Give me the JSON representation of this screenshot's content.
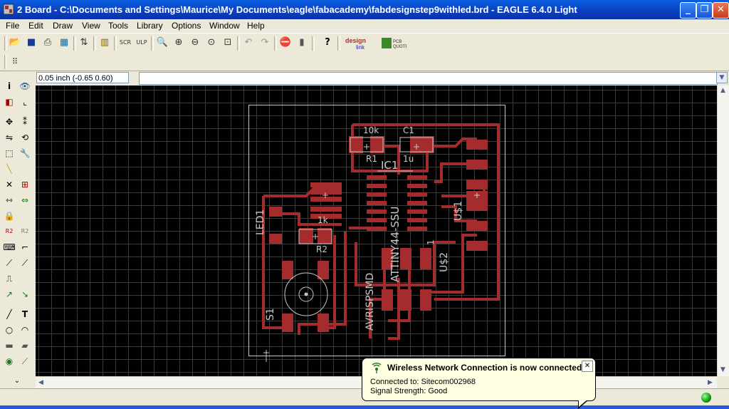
{
  "window": {
    "title": "2 Board - C:\\Documents and Settings\\Maurice\\My Documents\\eagle\\fabacademy\\fabdesignstep9withled.brd - EAGLE 6.4.0 Light",
    "controls": [
      "minimize",
      "maximize",
      "close"
    ]
  },
  "menu": [
    "File",
    "Edit",
    "Draw",
    "View",
    "Tools",
    "Library",
    "Options",
    "Window",
    "Help"
  ],
  "toolbar_icons": [
    "open-icon",
    "save-icon",
    "print-icon",
    "cam-icon",
    "script-icon",
    "library-icon",
    "scr-icon",
    "ulp-icon",
    "zoom-fit-icon",
    "zoom-in-icon",
    "zoom-out-icon",
    "zoom-redraw-icon",
    "zoom-select-icon",
    "undo-icon",
    "redo-icon",
    "stop-icon",
    "go-icon",
    "help-icon",
    "design-link-icon",
    "pcb-quote-icon"
  ],
  "coordinates": "0.05 inch (-0.65 0.60)",
  "command_input": "",
  "left_tools": [
    "info",
    "show",
    "display",
    "mark",
    "move",
    "copy",
    "mirror",
    "rotate",
    "group",
    "change",
    "delete",
    "add",
    "paste",
    "smash",
    "name",
    "value",
    "miter",
    "split",
    "optimize",
    "route",
    "ripup",
    "wire",
    "text",
    "circle",
    "arc",
    "rect",
    "polygon",
    "via",
    "signal"
  ],
  "board": {
    "labels": {
      "r1_value": "10k",
      "c1_value": "1u",
      "r1_name": "R1",
      "c1_name": "C1",
      "ic1_name": "IC1",
      "ic1_value": "ATTINY44-SSU",
      "us1": "U$1",
      "us2": "U$2",
      "led1": "LED1",
      "r2_value": "1k",
      "r2_name": "R2",
      "avrisp": "AVRISPSMD",
      "s1": "S1",
      "pin1": "1"
    },
    "colors": {
      "background": "#000000",
      "grid": "#3b3b3b",
      "copper": "#a52c2c",
      "silk": "#c8c8c8"
    }
  },
  "notification": {
    "title": "Wireless Network Connection is now connected",
    "line1": "Connected to: Sitecom002968",
    "line2": "Signal Strength: Good"
  },
  "status": {
    "indicator": "green"
  }
}
